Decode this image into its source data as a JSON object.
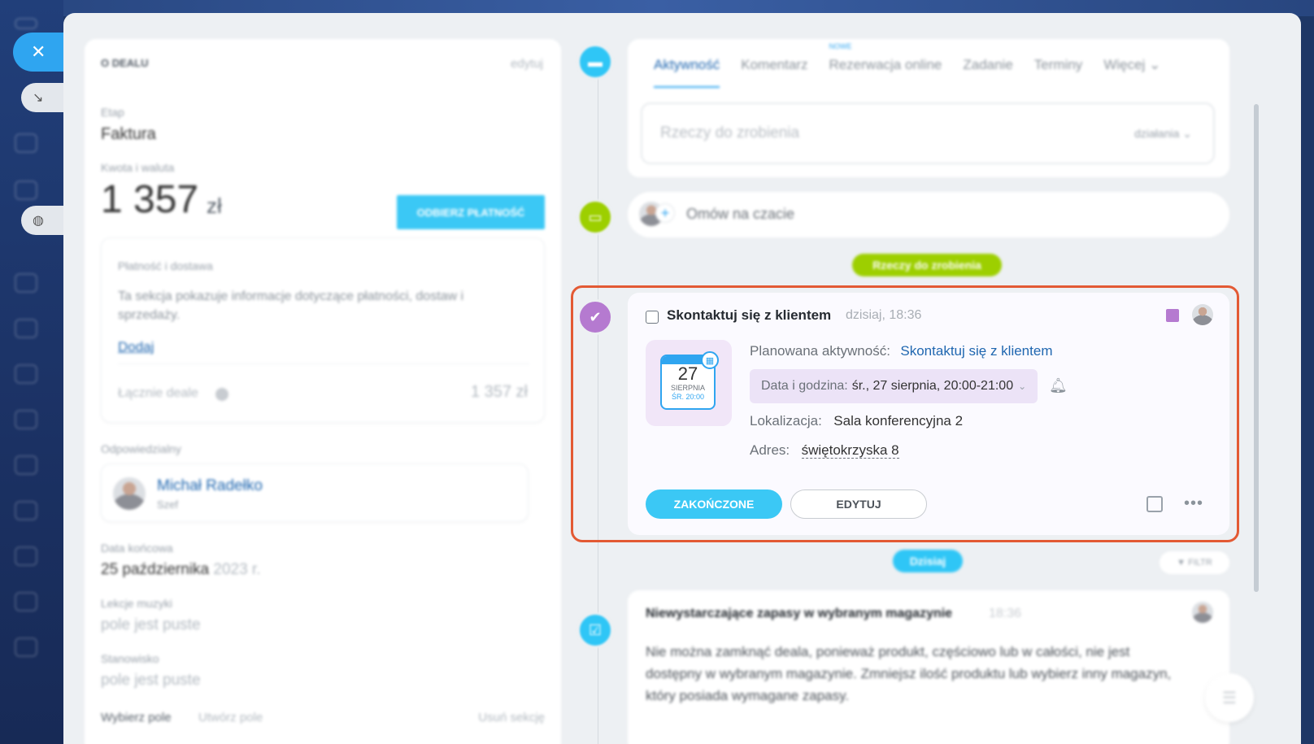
{
  "colors": {
    "accent": "#3bc8f5",
    "link": "#2067b0",
    "highlight": "#e35a34",
    "todo_green": "#9dcf00",
    "activity_purple": "#b57ad0"
  },
  "deal": {
    "section_title": "O DEALU",
    "edit_label": "edytuj",
    "stage_label": "Etap",
    "stage_value": "Faktura",
    "amount_label": "Kwota i waluta",
    "amount_value": "1 357",
    "currency": "zł",
    "receive_payment_button": "ODBIERZ PŁATNOŚĆ",
    "payments_title": "Płatność i dostawa",
    "payments_desc": "Ta sekcja pokazuje informacje dotyczące płatności, dostaw i sprzedaży.",
    "add_link": "Dodaj",
    "total_label": "Łącznie deale",
    "total_value": "1 357 zł",
    "responsible_label": "Odpowiedzialny",
    "responsible_name": "Michał Radełko",
    "responsible_role": "Szef",
    "end_date_label": "Data końcowa",
    "end_date_value": "25 października",
    "end_date_year": "2023 r.",
    "field1_label": "Lekcje muzyki",
    "field1_value": "pole jest puste",
    "field2_label": "Stanowisko",
    "field2_value": "pole jest puste",
    "footer_select": "Wybierz pole",
    "footer_create": "Utwórz pole",
    "footer_delete": "Usuń sekcję"
  },
  "timeline": {
    "tabs": [
      {
        "label": "Aktywność"
      },
      {
        "label": "Komentarz"
      },
      {
        "label": "Rezerwacja online",
        "badge": "NOWE"
      },
      {
        "label": "Zadanie"
      },
      {
        "label": "Terminy"
      },
      {
        "label": "Więcej"
      }
    ],
    "todo_placeholder": "Rzeczy do zrobienia",
    "actions_label": "działania",
    "chat_label": "Omów na czacie",
    "todo_pill": "Rzeczy do zrobienia",
    "today_pill": "Dzisiaj",
    "filter_label": "FILTR"
  },
  "activity": {
    "title": "Skontaktuj się z klientem",
    "time": "dzisiaj, 18:36",
    "calendar": {
      "day": "27",
      "month": "SIERPNIA",
      "dow": "ŚR. 20:00"
    },
    "planned_label": "Planowana aktywność:",
    "planned_value": "Skontaktuj się z klientem",
    "date_label": "Data i godzina:",
    "date_value": "śr., 27 sierpnia, 20:00-21:00",
    "location_label": "Lokalizacja:",
    "location_value": "Sala konferencyjna 2",
    "address_label": "Adres:",
    "address_value": "świętokrzyska 8",
    "done_button": "ZAKOŃCZONE",
    "edit_button": "EDYTUJ"
  },
  "notice": {
    "title": "Niewystarczające zapasy w wybranym magazynie",
    "time": "18:36",
    "body": "Nie można zamknąć deala, ponieważ produkt, częściowo lub w całości, nie jest dostępny w wybranym magazynie. Zmniejsz ilość produktu lub wybierz inny magazyn, który posiada wymagane zapasy."
  }
}
